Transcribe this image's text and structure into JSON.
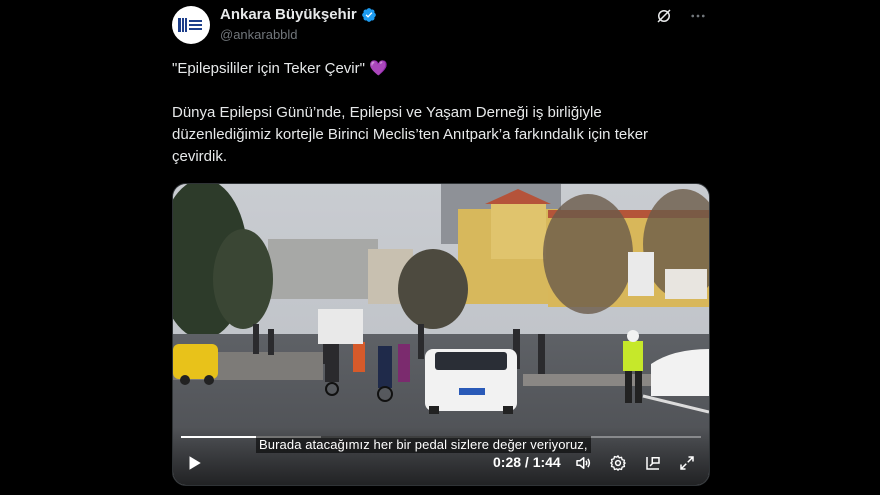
{
  "author": {
    "name": "Ankara Büyükşehir",
    "handle": "@ankarabbld",
    "avatar_icon": "ankara-municipality-logo",
    "verified_color": "#1d9bf0"
  },
  "header_actions": {
    "grok_icon": "grok-icon",
    "more_icon": "more-dots-icon"
  },
  "tweet": {
    "title_line": "\"Epilepsililer için Teker Çevir\"",
    "title_emoji": "💜",
    "body": "Dünya Epilepsi Günü’nde, Epilepsi ve Yaşam Derneği iş birliğiyle\ndüzenlediğimiz kortejle Birinci Meclis’ten Anıtpark’a farkındalık için teker\nçevirdik."
  },
  "video": {
    "caption": "Burada atacağımız her bir pedal sizlere değer veriyoruz,",
    "time": "0:28 / 1:44",
    "progress": 0.27,
    "icons": {
      "play": "play-icon",
      "volume": "volume-icon",
      "settings": "settings-gear-icon",
      "pip": "picture-in-picture-icon",
      "fullscreen": "fullscreen-icon"
    }
  }
}
